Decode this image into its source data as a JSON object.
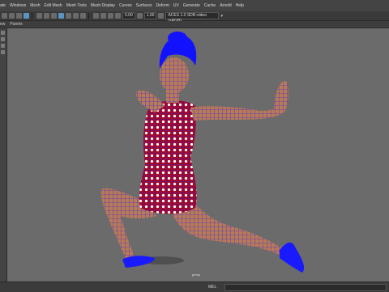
{
  "menus": [
    "ate",
    "Windows",
    "Mesh",
    "Edit Mesh",
    "Mesh Tools",
    "Mesh Display",
    "Curves",
    "Surfaces",
    "Deform",
    "UV",
    "Generate",
    "Cache",
    "Arnold",
    "Help"
  ],
  "shelf": {
    "field_a": "0.00",
    "field_b": "1.00",
    "camera_select": "ACES 1.0 SDR-video (sRGB)"
  },
  "panel_menus": [
    "ew",
    "Panels"
  ],
  "viewport": {
    "camera_label": "persp"
  },
  "status": {
    "command_label": "MEL"
  },
  "colors": {
    "viewport_bg": "#6b6b6b",
    "wire": "#0a10ff",
    "dress": "#a10a2a",
    "skin": "#b97a56"
  },
  "icons": [
    "select-icon",
    "move-icon",
    "rotate-icon",
    "scale-icon",
    "camera-icon",
    "grid-icon",
    "lighting-icon",
    "shading-icon"
  ]
}
